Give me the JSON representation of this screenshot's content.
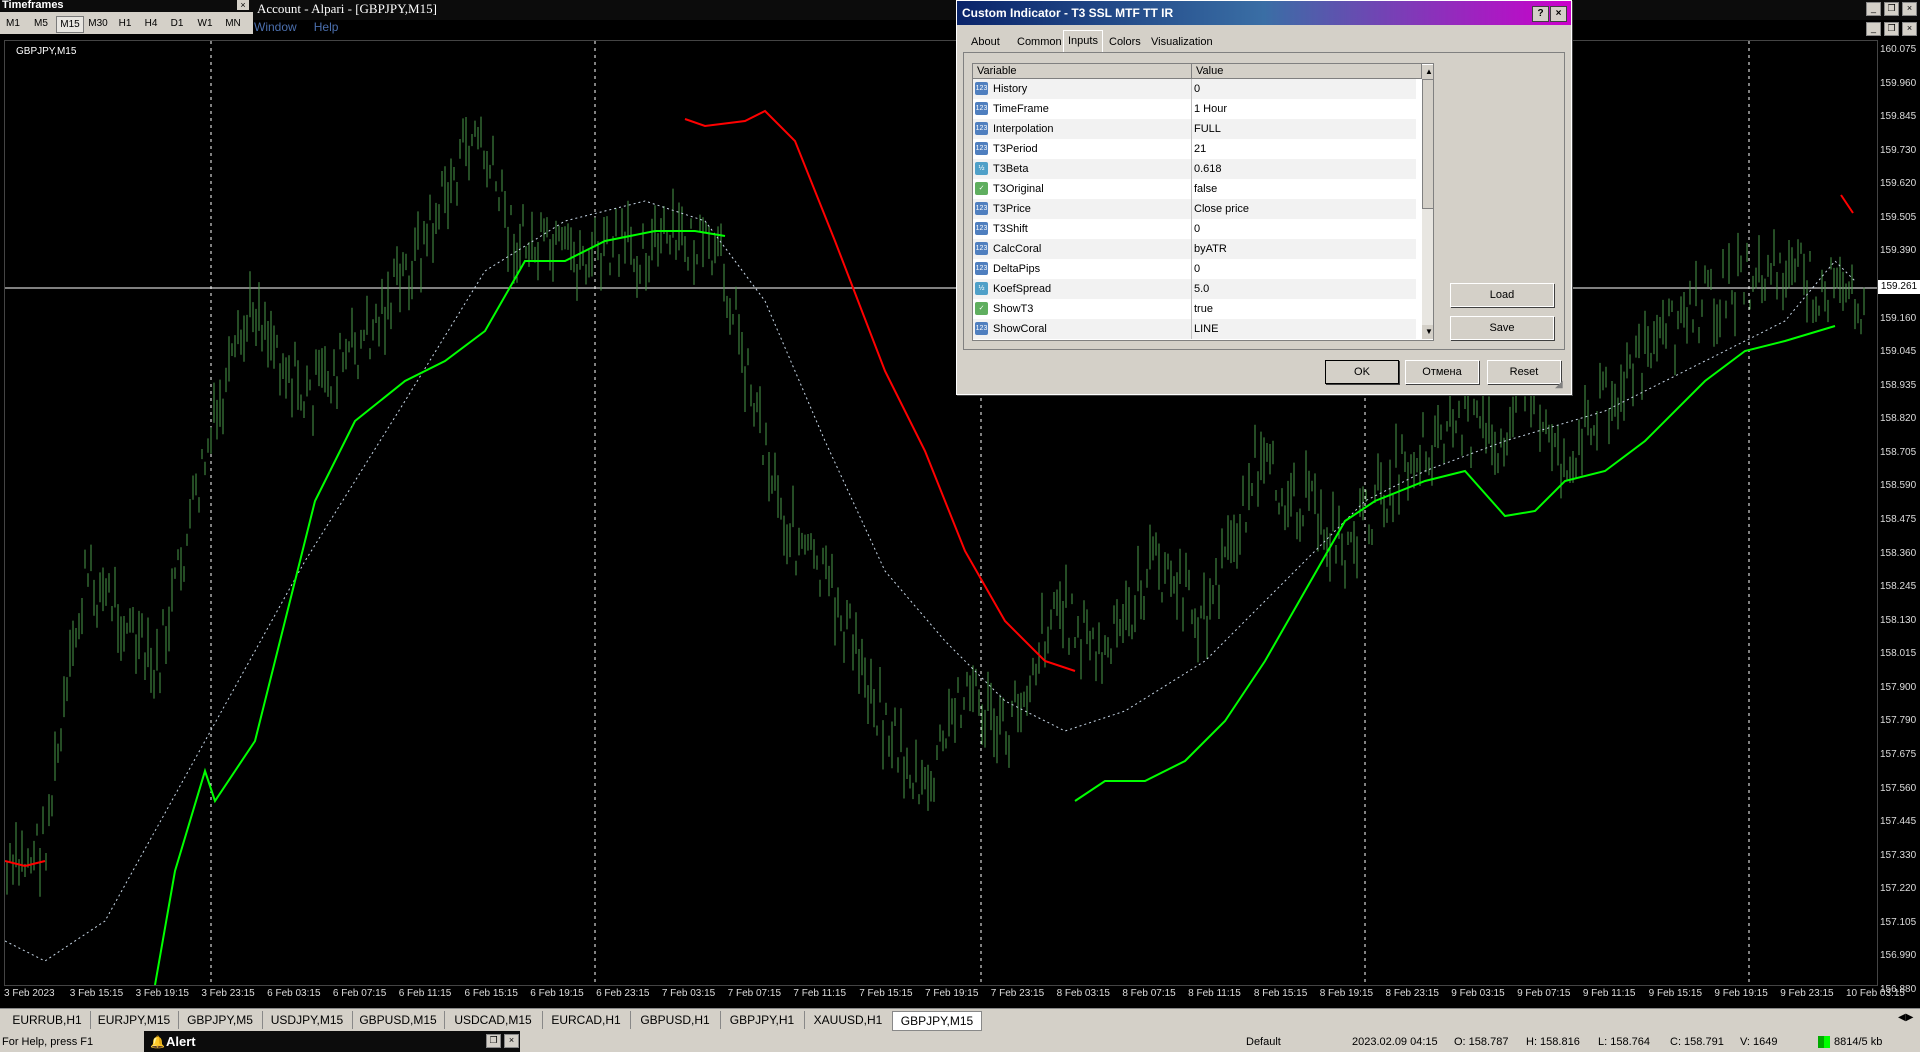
{
  "timeframes_panel": {
    "title": "Timeframes",
    "close": "×",
    "buttons": [
      "M1",
      "M5",
      "M15",
      "M30",
      "H1",
      "H4",
      "D1",
      "W1",
      "MN"
    ],
    "active": "M15"
  },
  "app": {
    "title": "Account - Alpari - [GBPJPY,M15]",
    "menu": [
      "Window",
      "Help"
    ]
  },
  "chart": {
    "label": "GBPJPY,M15",
    "current_price": "159.261",
    "price_ticks": [
      "160.075",
      "159.960",
      "159.845",
      "159.730",
      "159.620",
      "159.505",
      "159.390",
      "159.261",
      "159.160",
      "159.045",
      "158.935",
      "158.820",
      "158.705",
      "158.590",
      "158.475",
      "158.360",
      "158.245",
      "158.130",
      "158.015",
      "157.900",
      "157.790",
      "157.675",
      "157.560",
      "157.445",
      "157.330",
      "157.220",
      "157.105",
      "156.990",
      "156.880"
    ],
    "time_ticks": [
      "3 Feb 2023",
      "3 Feb 15:15",
      "3 Feb 19:15",
      "3 Feb 23:15",
      "6 Feb 03:15",
      "6 Feb 07:15",
      "6 Feb 11:15",
      "6 Feb 15:15",
      "6 Feb 19:15",
      "6 Feb 23:15",
      "7 Feb 03:15",
      "7 Feb 07:15",
      "7 Feb 11:15",
      "7 Feb 15:15",
      "7 Feb 19:15",
      "7 Feb 23:15",
      "8 Feb 03:15",
      "8 Feb 07:15",
      "8 Feb 11:15",
      "8 Feb 15:15",
      "8 Feb 19:15",
      "8 Feb 23:15",
      "9 Feb 03:15",
      "9 Feb 07:15",
      "9 Feb 11:15",
      "9 Feb 15:15",
      "9 Feb 19:15",
      "9 Feb 23:15",
      "10 Feb 03:15"
    ],
    "colors": {
      "candles": "#4a9a4a",
      "ssl_up": "#00ff00",
      "ssl_down": "#ff0000",
      "t3": "#c8d8e8",
      "grid": "#ffffff"
    }
  },
  "dialog": {
    "title": "Custom Indicator - T3 SSL MTF TT IR",
    "help_btn": "?",
    "close_btn": "×",
    "tabs": [
      "About",
      "Common",
      "Inputs",
      "Colors",
      "Visualization"
    ],
    "active_tab": "Inputs",
    "columns": [
      "Variable",
      "Value"
    ],
    "rows": [
      {
        "icon": "int",
        "name": "History",
        "value": "0"
      },
      {
        "icon": "int",
        "name": "TimeFrame",
        "value": "1 Hour"
      },
      {
        "icon": "int",
        "name": "Interpolation",
        "value": "FULL"
      },
      {
        "icon": "int",
        "name": "T3Period",
        "value": "21"
      },
      {
        "icon": "dbl",
        "name": "T3Beta",
        "value": "0.618"
      },
      {
        "icon": "bool",
        "name": "T3Original",
        "value": "false"
      },
      {
        "icon": "int",
        "name": "T3Price",
        "value": "Close price"
      },
      {
        "icon": "int",
        "name": "T3Shift",
        "value": "0"
      },
      {
        "icon": "int",
        "name": "CalcCoral",
        "value": "byATR"
      },
      {
        "icon": "int",
        "name": "DeltaPips",
        "value": "0"
      },
      {
        "icon": "dbl",
        "name": "KoefSpread",
        "value": "5.0"
      },
      {
        "icon": "bool",
        "name": "ShowT3",
        "value": "true"
      },
      {
        "icon": "int",
        "name": "ShowCoral",
        "value": "LINE"
      }
    ],
    "load": "Load",
    "save": "Save",
    "ok": "OK",
    "cancel": "Отмена",
    "reset": "Reset"
  },
  "symbol_tabs": [
    "EURRUB,H1",
    "EURJPY,M15",
    "GBPJPY,M5",
    "USDJPY,M15",
    "GBPUSD,M15",
    "USDCAD,M15",
    "EURCAD,H1",
    "GBPUSD,H1",
    "GBPJPY,H1",
    "XAUUSD,H1",
    "GBPJPY,M15"
  ],
  "active_symbol_tab": "GBPJPY,M15",
  "status": {
    "help": "For Help, press F1",
    "alert": "Alert",
    "profile": "Default",
    "datetime": "2023.02.09 04:15",
    "open": "O: 158.787",
    "high": "H: 158.816",
    "low": "L: 158.764",
    "close": "C: 158.791",
    "volume": "V: 1649",
    "traffic": "8814/5 kb"
  }
}
